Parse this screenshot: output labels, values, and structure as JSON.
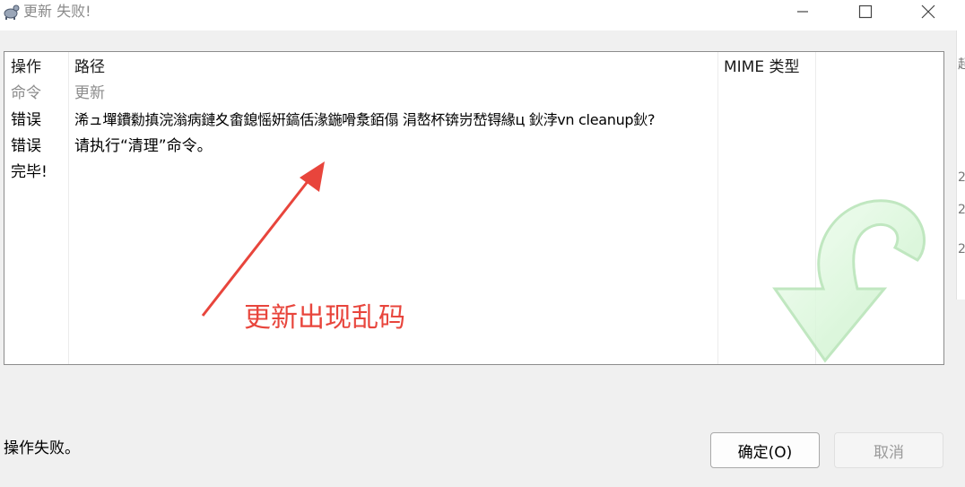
{
  "window": {
    "title": "更新 失败!"
  },
  "window_controls": {
    "minimize_glyph": "—",
    "maximize_glyph": "☐",
    "close_glyph": "✕"
  },
  "edge_glyphs": [
    "起",
    "2",
    "2",
    "2"
  ],
  "table": {
    "headers": {
      "action": "操作",
      "path": "路径",
      "mime": "MIME 类型"
    },
    "rows": [
      {
        "action": "命令",
        "path": "更新"
      },
      {
        "action": "错误",
        "path": "浠ュ墠鐨勬搷浣滃病鏈夊畬鎴愮姸鎬佸湪鍦嗗洜銆傝    涓嶅杯锛岃嵆锝緣ц    鈥浡vn cleanup鈥?"
      },
      {
        "action": "错误",
        "path": "请执行“清理”命令。"
      },
      {
        "action": "完毕!",
        "path": ""
      }
    ]
  },
  "annotation": {
    "text": "更新出现乱码",
    "color": "#e8453c"
  },
  "status": {
    "text": "操作失败。"
  },
  "buttons": {
    "ok_label": "确定(O)",
    "cancel_label": "取消"
  },
  "icons": {
    "app": "tortoise-icon",
    "watermark": "update-arrow-icon"
  }
}
